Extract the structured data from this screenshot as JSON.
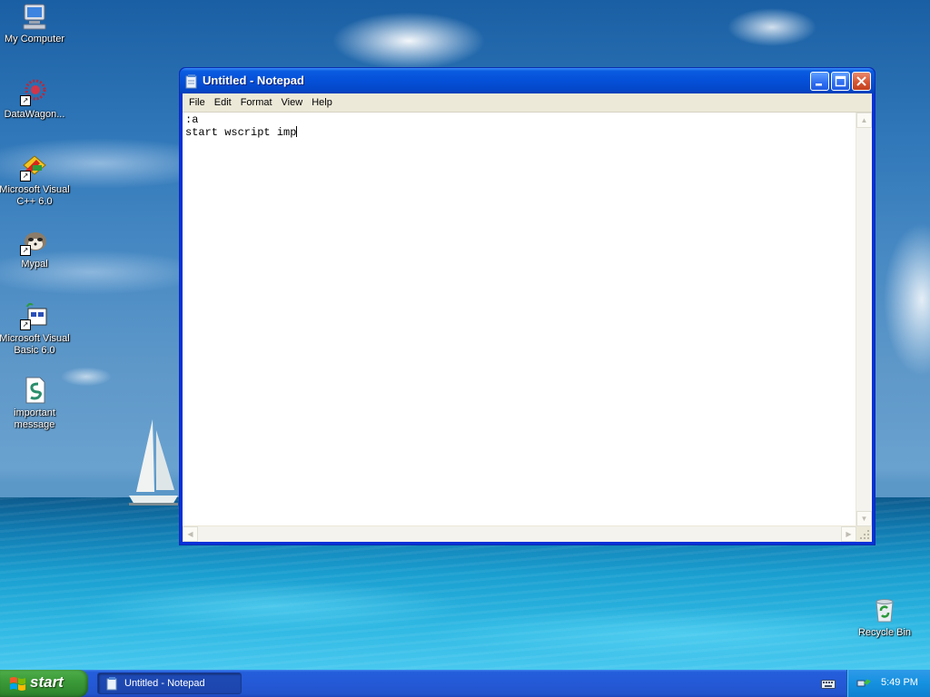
{
  "desktop": {
    "icons": [
      {
        "label": "My Computer",
        "icon": "my-computer-icon"
      },
      {
        "label": "DataWagon...",
        "icon": "datawagon-icon"
      },
      {
        "label": "Microsoft Visual C++ 6.0",
        "icon": "visual-cpp-icon"
      },
      {
        "label": "Mypal",
        "icon": "mypal-icon"
      },
      {
        "label": "Microsoft Visual Basic 6.0",
        "icon": "visual-basic-icon"
      },
      {
        "label": "important message",
        "icon": "script-file-icon"
      },
      {
        "label": "Recycle Bin",
        "icon": "recycle-bin-icon"
      }
    ]
  },
  "notepad": {
    "title": "Untitled - Notepad",
    "menu": [
      "File",
      "Edit",
      "Format",
      "View",
      "Help"
    ],
    "content": ":a\nstart wscript imp"
  },
  "taskbar": {
    "start_label": "start",
    "task_label": "Untitled - Notepad",
    "clock": "5:49 PM"
  },
  "colors": {
    "titlebar": "#0550d8",
    "taskbar": "#245edb",
    "start_button": "#3c9b39",
    "tray": "#1491e0"
  }
}
